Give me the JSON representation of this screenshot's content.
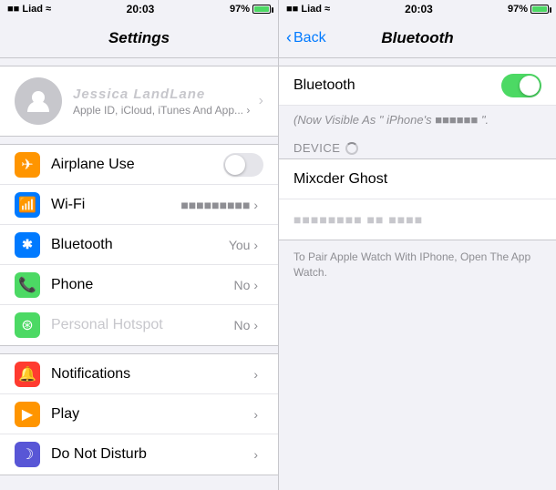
{
  "left": {
    "statusBar": {
      "carrier": "■■ Liad ≈",
      "time": "20:03",
      "battery": "97%",
      "wifiIcon": "≈"
    },
    "navTitle": "Settings",
    "profile": {
      "name": "Jessica LandLane",
      "sub": "Apple ID, iCloud, iTunes And App... ›"
    },
    "groups": [
      {
        "items": [
          {
            "iconClass": "icon-orange",
            "icon": "✈",
            "label": "Airplane Use",
            "value": "",
            "hasToggle": true,
            "toggleOn": false
          },
          {
            "iconClass": "icon-blue",
            "icon": "📶",
            "label": "Wi-Fi",
            "value": "■■■■■■■■■ ›",
            "hasToggle": false
          },
          {
            "iconClass": "icon-blue2",
            "icon": "✱",
            "label": "Bluetooth",
            "value": "You ›",
            "hasToggle": false
          },
          {
            "iconClass": "icon-green",
            "icon": "📞",
            "label": "Phone",
            "value": "No ›",
            "hasToggle": false
          },
          {
            "iconClass": "icon-green",
            "icon": "⊛",
            "label": "Personal Hotspot",
            "value": "No ›",
            "hasToggle": false,
            "dimmed": true
          }
        ]
      },
      {
        "items": [
          {
            "iconClass": "icon-red2",
            "icon": "🔔",
            "label": "Notifications",
            "value": "›",
            "hasToggle": false
          },
          {
            "iconClass": "icon-orange2",
            "icon": "▶",
            "label": "Play",
            "value": "›",
            "hasToggle": false
          },
          {
            "iconClass": "icon-purple",
            "icon": "☽",
            "label": "Do Not Disturb",
            "value": "›",
            "hasToggle": false
          }
        ]
      }
    ]
  },
  "right": {
    "statusBar": {
      "carrier": "■■ Liad ≈",
      "time": "20:03",
      "battery": "97%"
    },
    "backLabel": "Back",
    "navTitle": "Bluetooth",
    "bluetooth": {
      "label": "Bluetooth",
      "toggleOn": true,
      "visibleAs": "(Now Visible As \" iPhone's ■■■■■■ \".",
      "sectionHeader": "DEVICE",
      "devices": [
        {
          "name": "Mixcder Ghost",
          "sub": ""
        },
        {
          "name": "■■■■■■■■ ■■ ■■■■",
          "sub": ""
        }
      ],
      "footer": "To Pair Apple Watch With IPhone, Open The App Watch."
    }
  }
}
